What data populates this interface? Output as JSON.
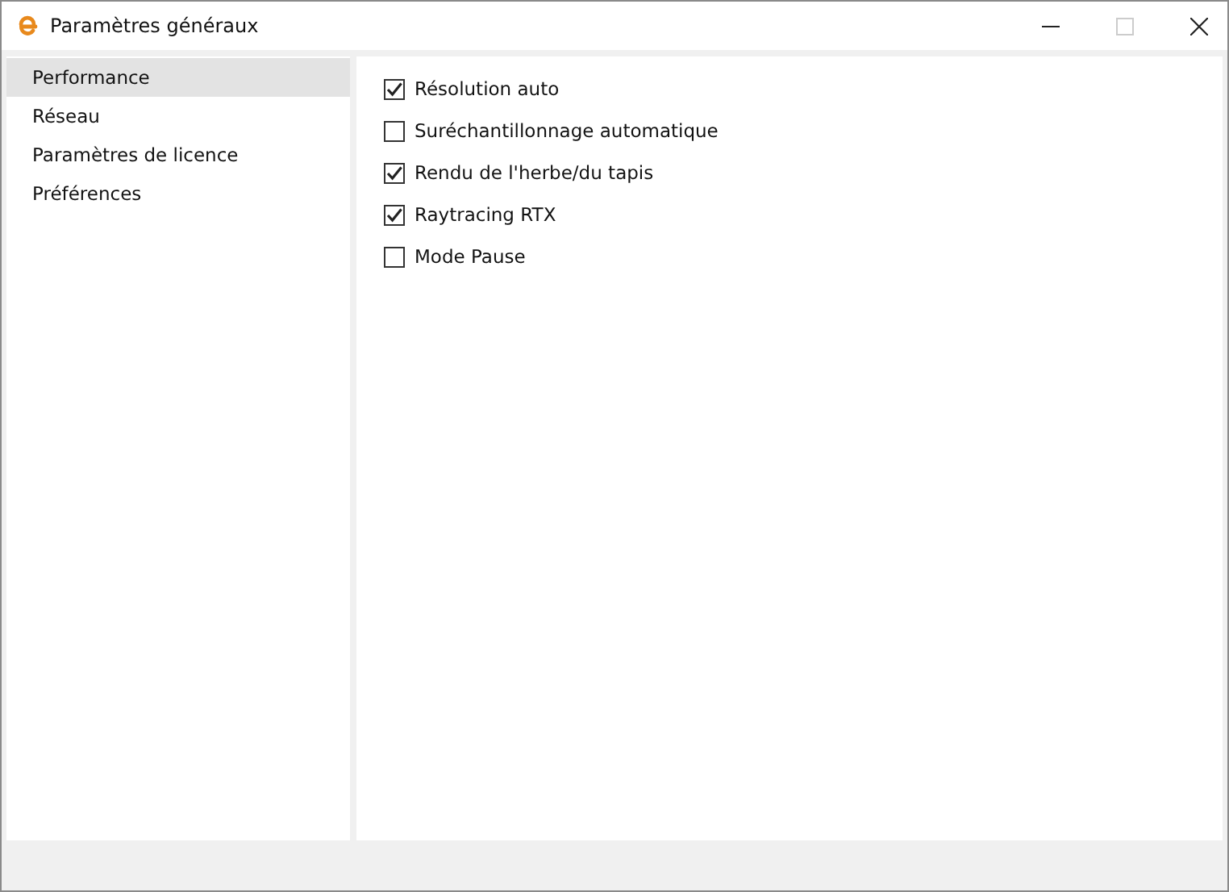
{
  "window": {
    "title": "Paramètres généraux"
  },
  "sidebar": {
    "items": [
      {
        "label": "Performance",
        "selected": true
      },
      {
        "label": "Réseau",
        "selected": false
      },
      {
        "label": "Paramètres de licence",
        "selected": false
      },
      {
        "label": "Préférences",
        "selected": false
      }
    ]
  },
  "options": [
    {
      "label": "Résolution auto",
      "checked": true
    },
    {
      "label": "Suréchantillonnage automatique",
      "checked": false
    },
    {
      "label": "Rendu de l'herbe/du tapis",
      "checked": true
    },
    {
      "label": "Raytracing RTX",
      "checked": true
    },
    {
      "label": "Mode Pause",
      "checked": false
    }
  ]
}
